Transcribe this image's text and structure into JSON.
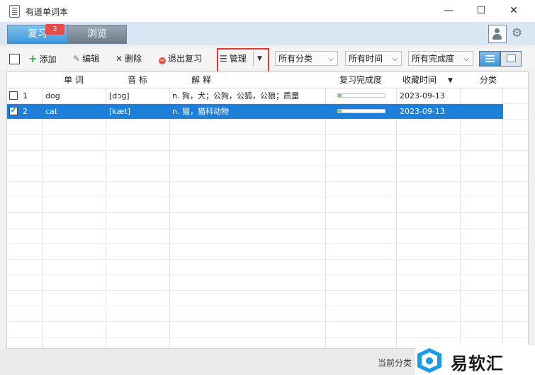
{
  "window": {
    "title": "有道单词本",
    "minimize": "—",
    "maximize": "☐",
    "close": "✕"
  },
  "tabs": [
    {
      "label": "复习"
    },
    {
      "label": "浏览"
    }
  ],
  "review_badge": "2",
  "toolbar": {
    "add": "添加",
    "edit": "编辑",
    "delete": "删除",
    "exit_review": "退出复习",
    "manage": "管理",
    "category_select": "所有分类",
    "time_select": "所有时间",
    "completion_select": "所有完成度"
  },
  "table": {
    "columns": [
      "单 词",
      "音 标",
      "解 释",
      "复习完成度",
      "收藏时间",
      "分类"
    ],
    "rows": [
      {
        "index": "1",
        "word": "dog",
        "phonetic": "[dɔɡ]",
        "meaning": "n. 狗，犬；公狗，公狐，公狼；质量",
        "progress": 0.08,
        "date": "2023-09-13",
        "category": "",
        "checked": false,
        "selected": false
      },
      {
        "index": "2",
        "word": "cat",
        "phonetic": "[kæt]",
        "meaning": "n. 猫，猫科动物",
        "progress": 0.08,
        "date": "2023-09-13",
        "category": "",
        "checked": true,
        "selected": true
      }
    ]
  },
  "status": {
    "text": "当前分类"
  },
  "brand": {
    "text": "易软汇"
  },
  "colors": {
    "accent": "#1e7fd8",
    "highlight_box": "#e03a3a",
    "badge": "#e74b4b"
  }
}
